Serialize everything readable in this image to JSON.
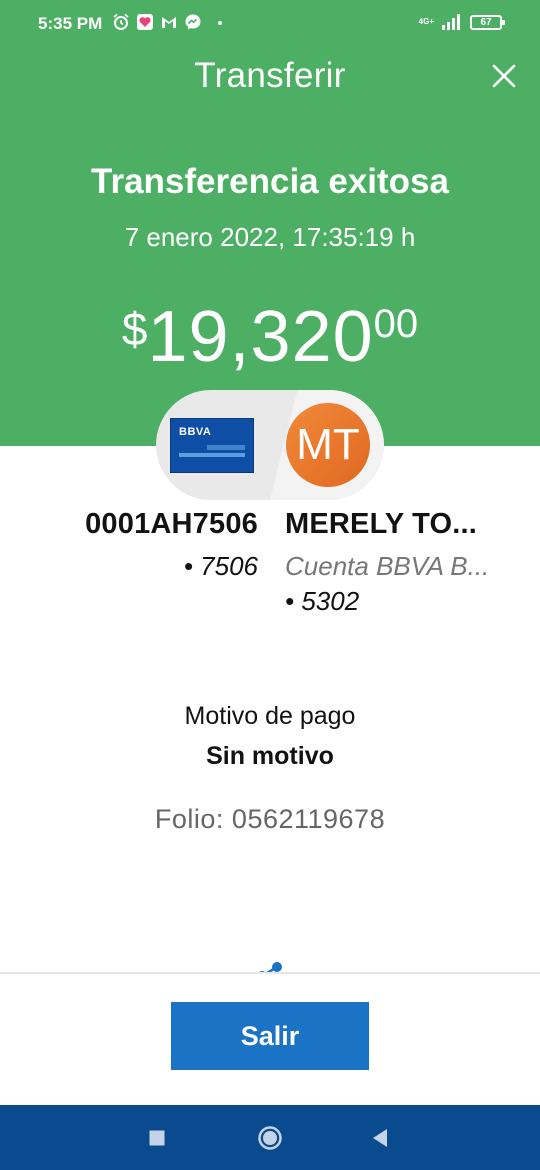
{
  "status_bar": {
    "time": "5:35 PM",
    "network": "4G+",
    "battery": "67",
    "left_icons": [
      "alarm-icon",
      "app-notification-icon",
      "gmail-icon",
      "messenger-icon"
    ],
    "right_icons": [
      "signal-icon",
      "battery-icon"
    ]
  },
  "header": {
    "title": "Transferir",
    "close_icon": "close-icon"
  },
  "receipt": {
    "title": "Transferencia exitosa",
    "date": "7 enero 2022, 17:35:19 h",
    "amount": {
      "currency": "$",
      "integer": "19,320",
      "decimals": "00"
    },
    "from": {
      "card_brand": "BBVA",
      "name": "0001AH7506",
      "number": "• 7506"
    },
    "to": {
      "initials": "MT",
      "name": "MERELY TO...",
      "account_type": "Cuenta BBVA B...",
      "number": "• 5302"
    },
    "reason_label": "Motivo de pago",
    "reason_value": "Sin motivo",
    "folio": "Folio: 0562119678"
  },
  "actions": {
    "exit_label": "Salir"
  },
  "nav": {
    "icons": [
      "square-recents-icon",
      "circle-home-icon",
      "triangle-back-icon"
    ]
  },
  "colors": {
    "header_green": "#4caf64",
    "button_blue": "#1a73c4",
    "nav_blue": "#0a4a8f",
    "avatar_orange": "#e8752a"
  }
}
